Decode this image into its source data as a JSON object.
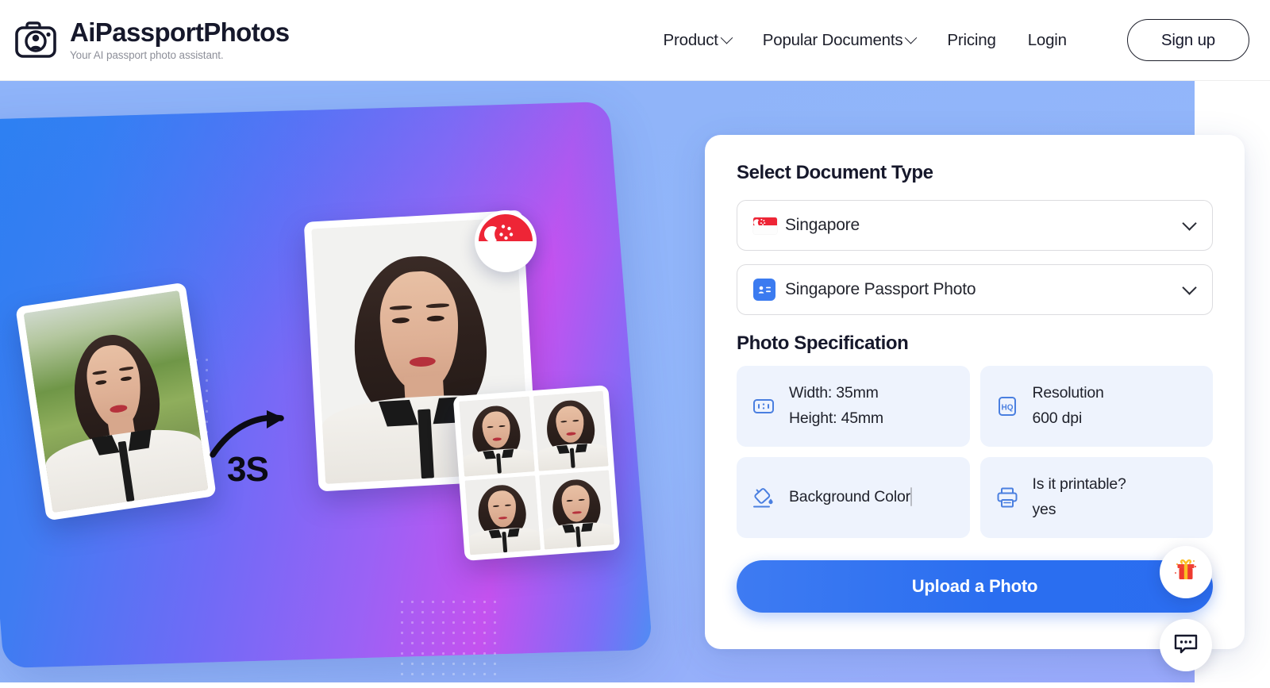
{
  "header": {
    "brand_name": "AiPassportPhotos",
    "brand_tagline": "Your AI passport photo assistant.",
    "logo_icon": "camera-portrait-icon",
    "nav": [
      {
        "label": "Product",
        "has_dropdown": true,
        "icon": "chevron-down-icon"
      },
      {
        "label": "Popular Documents",
        "has_dropdown": true,
        "icon": "chevron-down-icon"
      },
      {
        "label": "Pricing",
        "has_dropdown": false
      },
      {
        "label": "Login",
        "has_dropdown": false
      }
    ],
    "signup_label": "Sign up"
  },
  "hero": {
    "badge_icon": "singapore-flag-icon",
    "speed_label": "3S",
    "arrow_icon": "curved-arrow-right-icon",
    "before_photo_alt": "original-photo",
    "after_photo_alt": "passport-photo",
    "grid_photo_alt": "printable-photo-sheet"
  },
  "form": {
    "document_type_title": "Select Document Type",
    "country_select": {
      "value": "Singapore",
      "icon": "singapore-flag-icon",
      "chevron": "chevron-down-icon"
    },
    "document_select": {
      "value": "Singapore Passport Photo",
      "icon": "id-card-icon",
      "chevron": "chevron-down-icon"
    },
    "spec_title": "Photo Specification",
    "specs": [
      {
        "icon": "dimensions-icon",
        "line1": "Width: 35mm",
        "line2": "Height: 45mm",
        "type": "text"
      },
      {
        "icon": "hq-resolution-icon",
        "line1": "Resolution",
        "line2": "600 dpi",
        "type": "text"
      },
      {
        "icon": "paint-bucket-icon",
        "line1": "Background Color",
        "line2": "",
        "type": "swatch",
        "swatch_color": "#ffffff"
      },
      {
        "icon": "printer-icon",
        "line1": "Is it printable?",
        "line2": "yes",
        "type": "text"
      }
    ],
    "upload_label": "Upload a Photo"
  },
  "widgets": {
    "gift_icon": "gift-box-icon",
    "chat_icon": "chat-bubble-icon"
  },
  "colors": {
    "brand_dark": "#16182b",
    "accent_blue": "#2b6df0",
    "spec_card_bg": "#eef3fd",
    "hero_light_blue": "#8fb4f9",
    "hero_purple": "#9a62f5",
    "flag_red": "#ee2536"
  }
}
